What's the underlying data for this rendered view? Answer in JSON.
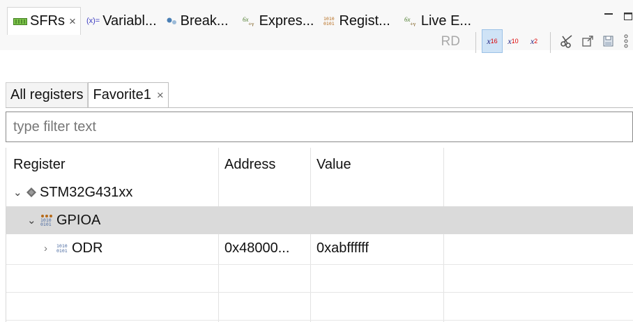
{
  "view_tabs": [
    {
      "label": "SFRs",
      "icon": "sfr-icon",
      "active": true
    },
    {
      "label": "Variabl...",
      "icon": "variables-icon",
      "prefix": "(x)="
    },
    {
      "label": "Break...",
      "icon": "breakpoints-icon"
    },
    {
      "label": "Expres...",
      "icon": "expressions-icon"
    },
    {
      "label": "Regist...",
      "icon": "registers-icon"
    },
    {
      "label": "Live E...",
      "icon": "live-expressions-icon"
    }
  ],
  "view_tab_close": "×",
  "window_controls": {
    "minimize": "▭",
    "maximize": "▢"
  },
  "toolbar": {
    "rd_label": "RD",
    "hex": {
      "x": "x",
      "sub": "16"
    },
    "dec": {
      "x": "x",
      "sub": "10"
    },
    "bin": {
      "x": "x",
      "sub": "2"
    },
    "menu": "⋮"
  },
  "sub_tabs": [
    {
      "label": "All registers",
      "active": false
    },
    {
      "label": "Favorite1",
      "active": true
    }
  ],
  "sub_tab_close": "×",
  "filter": {
    "placeholder": "type filter text",
    "value": ""
  },
  "table": {
    "columns": [
      "Register",
      "Address",
      "Value"
    ],
    "rows": [
      {
        "twisty": "⌄",
        "icon": "chip-icon",
        "name": "STM32G431xx",
        "address": "",
        "value": ""
      },
      {
        "twisty": "⌄",
        "icon": "peripheral-icon",
        "name": "GPIOA",
        "address": "",
        "value": "",
        "selected": true
      },
      {
        "twisty": "›",
        "icon": "register-icon",
        "name": "ODR",
        "address": "0x48000...",
        "value": "0xabffffff"
      }
    ]
  },
  "colors": {
    "selection": "#dadada",
    "pressed_button": "#cfe3f6",
    "tabbar_bg": "#f8f8f8"
  }
}
